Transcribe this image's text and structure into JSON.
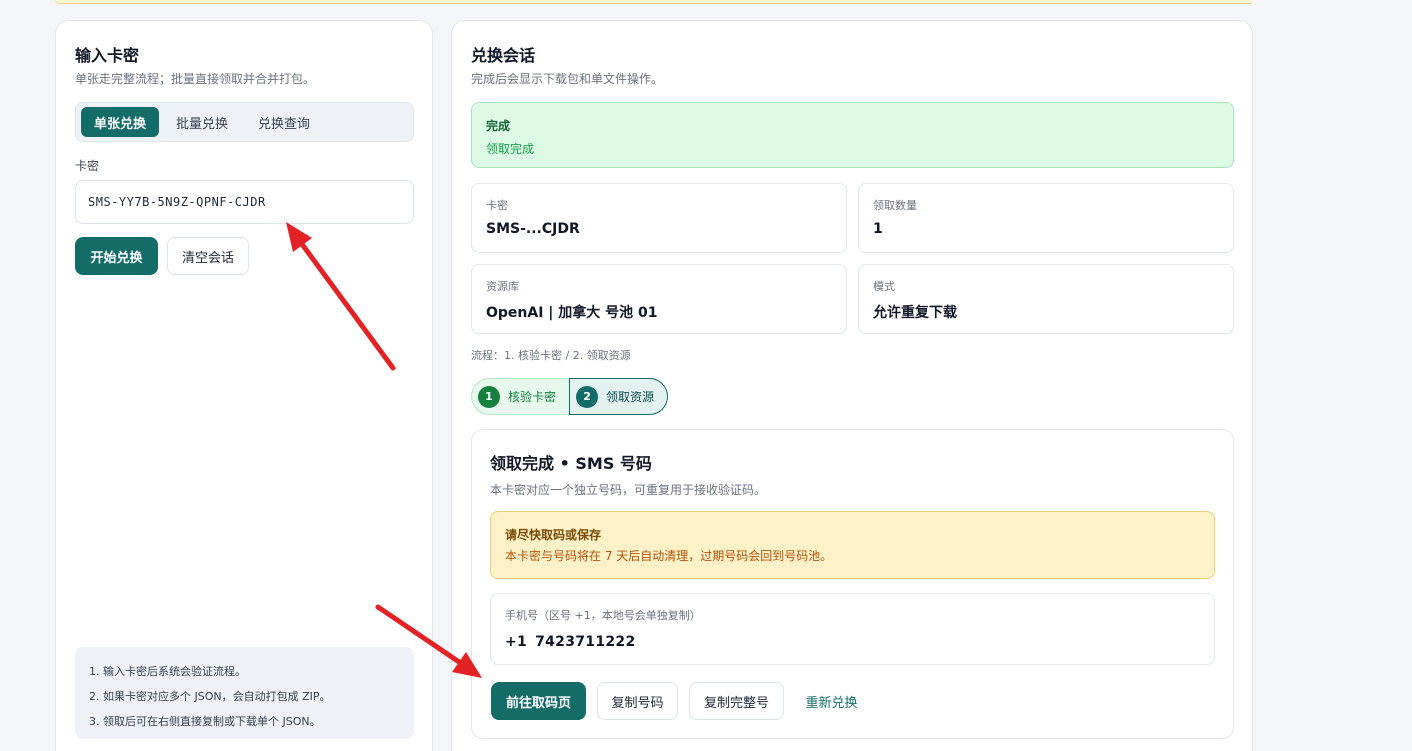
{
  "left_panel": {
    "title": "输入卡密",
    "subtitle": "单张走完整流程；批量直接领取并合并打包。",
    "tabs": [
      {
        "label": "单张兑换",
        "active": true
      },
      {
        "label": "批量兑换",
        "active": false
      },
      {
        "label": "兑换查询",
        "active": false
      }
    ],
    "field_label": "卡密",
    "key_value": "SMS-YY7B-5N9Z-QPNF-CJDR",
    "start_button": "开始兑换",
    "clear_button": "清空会话",
    "notes": [
      "1. 输入卡密后系统会验证流程。",
      "2. 如果卡密对应多个 JSON，会自动打包成 ZIP。",
      "3. 领取后可在右侧直接复制或下载单个 JSON。"
    ]
  },
  "right_panel": {
    "title": "兑换会话",
    "subtitle": "完成后会显示下载包和单文件操作。",
    "status": {
      "title": "完成",
      "text": "领取完成"
    },
    "info": {
      "card_label": "卡密",
      "card_value": "SMS-...CJDR",
      "count_label": "领取数量",
      "count_value": "1",
      "repo_label": "资源库",
      "repo_value": "OpenAI | 加拿大 号池 01",
      "mode_label": "模式",
      "mode_value": "允许重复下载"
    },
    "flow_text": "流程：1. 核验卡密 / 2. 领取资源",
    "steps": [
      {
        "num": "1",
        "label": "核验卡密"
      },
      {
        "num": "2",
        "label": "领取资源"
      }
    ],
    "result": {
      "title": "领取完成 • SMS 号码",
      "subtitle": "本卡密对应一个独立号码，可重复用于接收验证码。",
      "warning_title": "请尽快取码或保存",
      "warning_text": "本卡密与号码将在 7 天后自动清理，过期号码会回到号码池。",
      "phone_label": "手机号（区号 +1，本地号会单独复制）",
      "phone_cc": "+1",
      "phone_number": "7423711222",
      "goto_button": "前往取码页",
      "copy_number_button": "复制号码",
      "copy_full_button": "复制完整号",
      "redeem_again_link": "重新兑换"
    }
  },
  "colors": {
    "primary": "#146c68",
    "success_bg": "#dcfae5",
    "warning_bg": "#fdf1c8",
    "annotation_arrow": "#e32226"
  }
}
